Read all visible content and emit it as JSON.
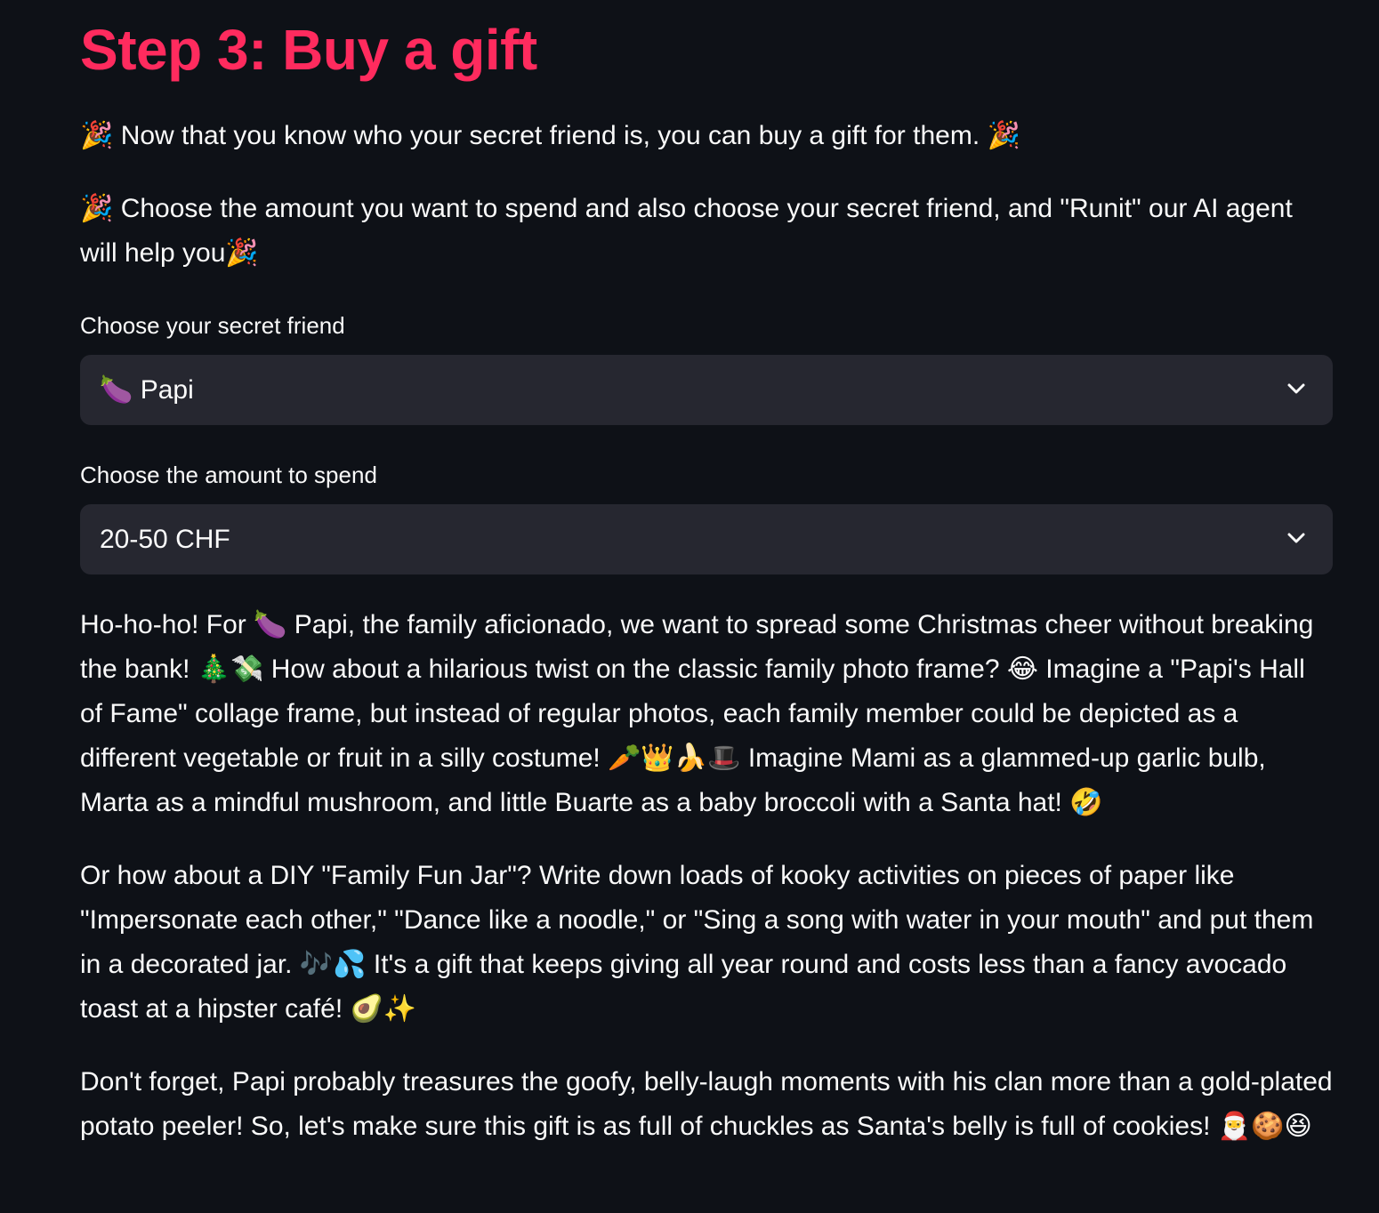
{
  "page": {
    "title": "Step 3: Buy a gift"
  },
  "intro": {
    "line1": "🎉 Now that you know who your secret friend is, you can buy a gift for them. 🎉",
    "line2": "🎉 Choose the amount you want to spend and also choose your secret friend, and \"Runit\" our AI agent will help you🎉"
  },
  "friend_select": {
    "label": "Choose your secret friend",
    "value": "🍆 Papi",
    "icon": "chevron-down-icon"
  },
  "amount_select": {
    "label": "Choose the amount to spend",
    "value": "20-50 CHF",
    "icon": "chevron-down-icon"
  },
  "response": {
    "paragraph1": "Ho-ho-ho! For 🍆 Papi, the family aficionado, we want to spread some Christmas cheer without breaking the bank! 🎄💸 How about a hilarious twist on the classic family photo frame? 😂 Imagine a \"Papi's Hall of Fame\" collage frame, but instead of regular photos, each family member could be depicted as a different vegetable or fruit in a silly costume! 🥕👑🍌🎩 Imagine Mami as a glammed-up garlic bulb, Marta as a mindful mushroom, and little Buarte as a baby broccoli with a Santa hat! 🤣",
    "paragraph2": "Or how about a DIY \"Family Fun Jar\"? Write down loads of kooky activities on pieces of paper like \"Impersonate each other,\" \"Dance like a noodle,\" or \"Sing a song with water in your mouth\" and put them in a decorated jar. 🎶💦 It's a gift that keeps giving all year round and costs less than a fancy avocado toast at a hipster café! 🥑✨",
    "paragraph3": "Don't forget, Papi probably treasures the goofy, belly-laugh moments with his clan more than a gold-plated potato peeler! So, let's make sure this gift is as full of chuckles as Santa's belly is full of cookies! 🎅🍪😆"
  },
  "colors": {
    "background": "#0e1117",
    "title": "#ff2b5e",
    "select_bg": "#262730",
    "text": "#fafafa"
  }
}
